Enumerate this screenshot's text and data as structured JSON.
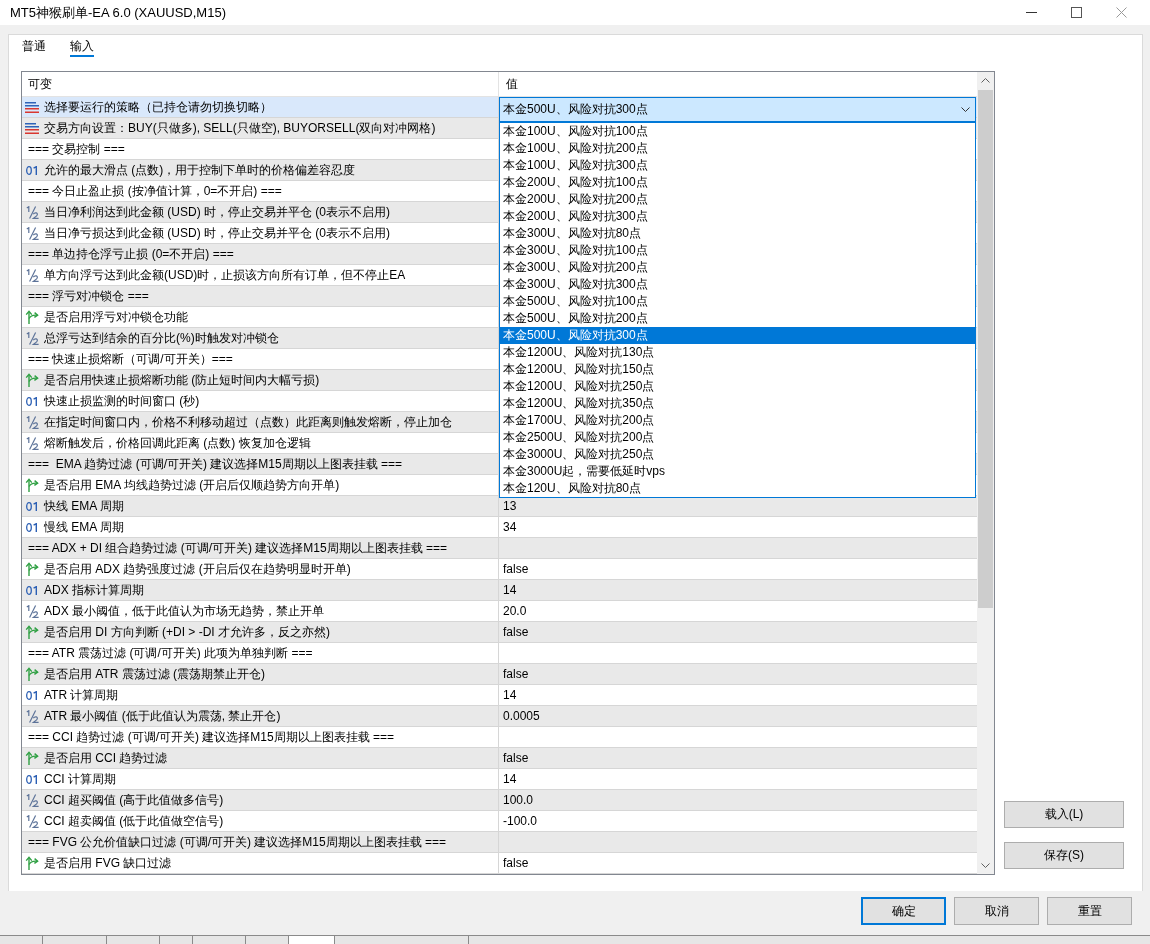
{
  "window": {
    "title": "MT5神猴刷单-EA 6.0 (XAUUSD,M15)"
  },
  "tabs": [
    {
      "label": "普通",
      "selected": false
    },
    {
      "label": "输入",
      "selected": true
    }
  ],
  "table": {
    "columns": [
      "可变",
      "值"
    ],
    "rows": [
      {
        "kind": "enum",
        "name": "选择要运行的策略（已持仓请勿切换切略）",
        "selected": true,
        "dropdown": {
          "value": "本金500U、风险对抗300点",
          "expanded": true,
          "options": [
            {
              "label": "本金100U、风险对抗100点",
              "selected": false
            },
            {
              "label": "本金100U、风险对抗200点",
              "selected": false
            },
            {
              "label": "本金100U、风险对抗300点",
              "selected": false
            },
            {
              "label": "本金200U、风险对抗100点",
              "selected": false
            },
            {
              "label": "本金200U、风险对抗200点",
              "selected": false
            },
            {
              "label": "本金200U、风险对抗300点",
              "selected": false
            },
            {
              "label": "本金300U、风险对抗80点",
              "selected": false
            },
            {
              "label": "本金300U、风险对抗100点",
              "selected": false
            },
            {
              "label": "本金300U、风险对抗200点",
              "selected": false
            },
            {
              "label": "本金300U、风险对抗300点",
              "selected": false
            },
            {
              "label": "本金500U、风险对抗100点",
              "selected": false
            },
            {
              "label": "本金500U、风险对抗200点",
              "selected": false
            },
            {
              "label": "本金500U、风险对抗300点",
              "selected": true
            },
            {
              "label": "本金1200U、风险对抗130点",
              "selected": false
            },
            {
              "label": "本金1200U、风险对抗150点",
              "selected": false
            },
            {
              "label": "本金1200U、风险对抗250点",
              "selected": false
            },
            {
              "label": "本金1200U、风险对抗350点",
              "selected": false
            },
            {
              "label": "本金1700U、风险对抗200点",
              "selected": false
            },
            {
              "label": "本金2500U、风险对抗200点",
              "selected": false
            },
            {
              "label": "本金3000U、风险对抗250点",
              "selected": false
            },
            {
              "label": "本金3000U起，需要低延时vps",
              "selected": false
            },
            {
              "label": "本金120U、风险对抗80点",
              "selected": false
            }
          ]
        }
      },
      {
        "kind": "enum",
        "name": "交易方向设置：BUY(只做多), SELL(只做空), BUYORSELL(双向对冲网格)",
        "selected": false
      },
      {
        "kind": "header",
        "name": "=== 交易控制 ===",
        "selected": false
      },
      {
        "kind": "int",
        "name": "允许的最大滑点 (点数)，用于控制下单时的价格偏差容忍度",
        "selected": false
      },
      {
        "kind": "header",
        "name": "=== 今日止盈止损 (按净值计算，0=不开启) ===",
        "selected": false
      },
      {
        "kind": "double",
        "name": "当日净利润达到此金额 (USD) 时，停止交易并平仓 (0表示不启用)",
        "selected": false
      },
      {
        "kind": "double",
        "name": "当日净亏损达到此金额 (USD) 时，停止交易并平仓 (0表示不启用)",
        "selected": false
      },
      {
        "kind": "header",
        "name": "=== 单边持仓浮亏止损 (0=不开启) ===",
        "selected": false
      },
      {
        "kind": "double",
        "name": "单方向浮亏达到此金额(USD)时，止损该方向所有订单，但不停止EA",
        "selected": false
      },
      {
        "kind": "header",
        "name": "=== 浮亏对冲锁仓 ===",
        "selected": false
      },
      {
        "kind": "bool",
        "name": "是否启用浮亏对冲锁仓功能",
        "selected": false
      },
      {
        "kind": "double",
        "name": "总浮亏达到结余的百分比(%)时触发对冲锁仓",
        "selected": false
      },
      {
        "kind": "header",
        "name": "=== 快速止损熔断（可调/可开关）===",
        "selected": false
      },
      {
        "kind": "bool",
        "name": "是否启用快速止损熔断功能 (防止短时间内大幅亏损)",
        "selected": false
      },
      {
        "kind": "int",
        "name": "快速止损监测的时间窗口 (秒)",
        "selected": false
      },
      {
        "kind": "double",
        "name": "在指定时间窗口内，价格不利移动超过（点数）此距离则触发熔断，停止加仓",
        "selected": false
      },
      {
        "kind": "double",
        "name": "熔断触发后，价格回调此距离 (点数) 恢复加仓逻辑",
        "selected": false
      },
      {
        "kind": "header",
        "name": "===  EMA 趋势过滤 (可调/可开关) 建议选择M15周期以上图表挂载 ===",
        "selected": false
      },
      {
        "kind": "bool",
        "name": "是否启用 EMA 均线趋势过滤 (开启后仅顺趋势方向开单)",
        "selected": false
      },
      {
        "kind": "int",
        "name": "快线 EMA 周期",
        "selected": false,
        "value": "13"
      },
      {
        "kind": "int",
        "name": "慢线 EMA 周期",
        "selected": false,
        "value": "34"
      },
      {
        "kind": "header",
        "name": "=== ADX + DI 组合趋势过滤 (可调/可开关) 建议选择M15周期以上图表挂载 ===",
        "selected": false
      },
      {
        "kind": "bool",
        "name": "是否启用 ADX 趋势强度过滤 (开启后仅在趋势明显时开单)",
        "selected": false,
        "value": "false"
      },
      {
        "kind": "int",
        "name": "ADX 指标计算周期",
        "selected": false,
        "value": "14"
      },
      {
        "kind": "double",
        "name": "ADX 最小阈值，低于此值认为市场无趋势，禁止开单",
        "selected": false,
        "value": "20.0"
      },
      {
        "kind": "bool",
        "name": "是否启用 DI 方向判断 (+DI > -DI 才允许多，反之亦然)",
        "selected": false,
        "value": "false"
      },
      {
        "kind": "header",
        "name": "=== ATR 震荡过滤 (可调/可开关) 此项为单独判断 ===",
        "selected": false
      },
      {
        "kind": "bool",
        "name": "是否启用 ATR 震荡过滤 (震荡期禁止开仓)",
        "selected": false,
        "value": "false"
      },
      {
        "kind": "int",
        "name": "ATR 计算周期",
        "selected": false,
        "value": "14"
      },
      {
        "kind": "double",
        "name": "ATR 最小阈值 (低于此值认为震荡, 禁止开仓)",
        "selected": false,
        "value": "0.0005"
      },
      {
        "kind": "header",
        "name": "=== CCI 趋势过滤 (可调/可开关) 建议选择M15周期以上图表挂载 ===",
        "selected": false
      },
      {
        "kind": "bool",
        "name": "是否启用 CCI 趋势过滤",
        "selected": false,
        "value": "false"
      },
      {
        "kind": "int",
        "name": "CCI 计算周期",
        "selected": false,
        "value": "14"
      },
      {
        "kind": "double",
        "name": "CCI 超买阈值 (高于此值做多信号)",
        "selected": false,
        "value": "100.0"
      },
      {
        "kind": "double",
        "name": "CCI 超卖阈值 (低于此值做空信号)",
        "selected": false,
        "value": "-100.0"
      },
      {
        "kind": "header",
        "name": "=== FVG 公允价值缺口过滤 (可调/可开关) 建议选择M15周期以上图表挂载 ===",
        "selected": false
      },
      {
        "kind": "bool",
        "name": "是否启用 FVG 缺口过滤",
        "selected": false,
        "value": "false"
      }
    ]
  },
  "side_buttons": [
    "载入(L)",
    "保存(S)"
  ],
  "dialog_buttons": [
    {
      "label": "确定",
      "default": true
    },
    {
      "label": "取消",
      "default": false
    },
    {
      "label": "重置",
      "default": false
    }
  ]
}
